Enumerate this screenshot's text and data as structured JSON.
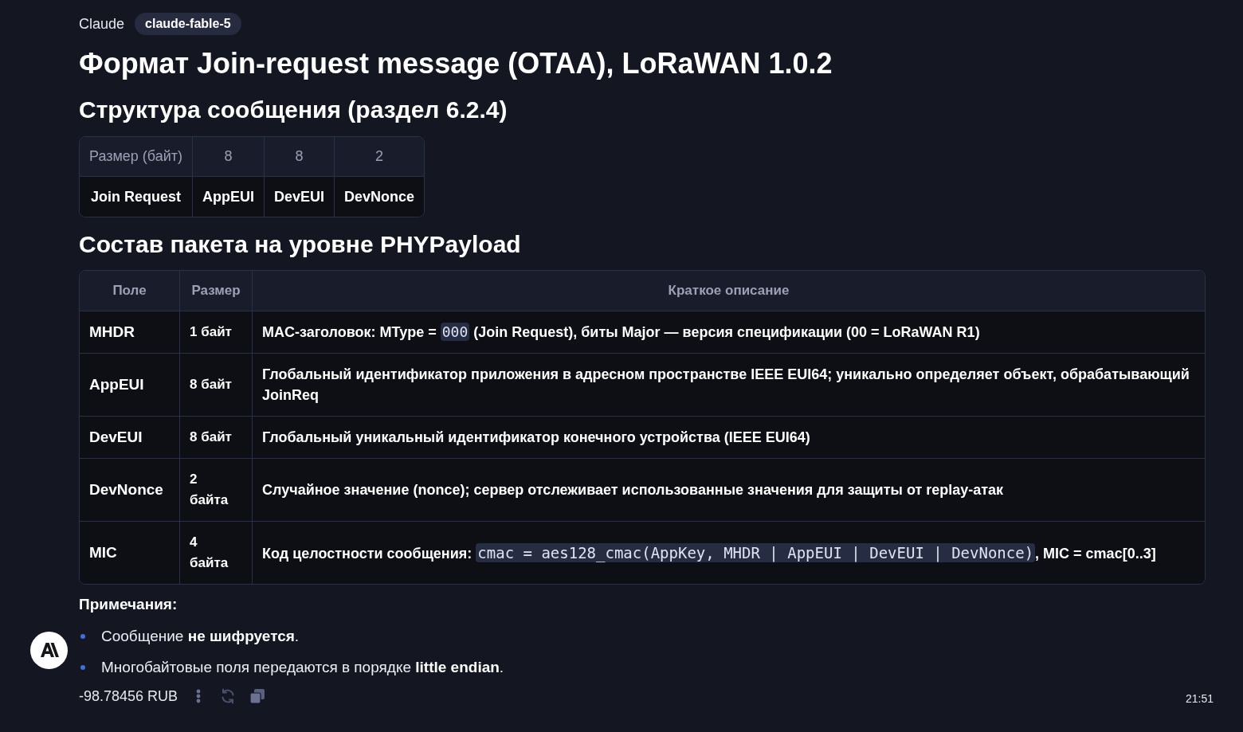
{
  "header": {
    "author": "Claude",
    "model_badge": "claude-fable-5"
  },
  "title": "Формат Join-request message (OTAA), LoRaWAN 1.0.2",
  "structure_heading": "Структура сообщения (раздел 6.2.4)",
  "structure_table": {
    "rows": [
      {
        "kind": "sizes",
        "cells": [
          "Размер (байт)",
          "8",
          "8",
          "2"
        ]
      },
      {
        "kind": "fields",
        "cells": [
          "Join Request",
          "AppEUI",
          "DevEUI",
          "DevNonce"
        ]
      }
    ]
  },
  "payload_heading": "Состав пакета на уровне PHYPayload",
  "payload_table": {
    "columns": [
      "Поле",
      "Размер",
      "Краткое описание"
    ],
    "rows": [
      {
        "field": "MHDR",
        "size": "1 байт",
        "description": [
          {
            "kind": "text",
            "text": "MAC-заголовок: MType = "
          },
          {
            "kind": "code",
            "text": "000"
          },
          {
            "kind": "text",
            "text": " (Join Request), биты Major — версия спецификации (00 = LoRaWAN R1)"
          }
        ]
      },
      {
        "field": "AppEUI",
        "size": "8 байт",
        "description": [
          {
            "kind": "text",
            "text": "Глобальный идентификатор приложения в адресном пространстве IEEE EUI64; уникально определяет объект, обрабатывающий JoinReq"
          }
        ]
      },
      {
        "field": "DevEUI",
        "size": "8 байт",
        "description": [
          {
            "kind": "text",
            "text": "Глобальный уникальный идентификатор конечного устройства (IEEE EUI64)"
          }
        ]
      },
      {
        "field": "DevNonce",
        "size": "2 байта",
        "description": [
          {
            "kind": "text",
            "text": "Случайное значение (nonce); сервер отслеживает использованные значения для защиты от replay-атак"
          }
        ]
      },
      {
        "field": "MIC",
        "size": "4 байта",
        "description": [
          {
            "kind": "text",
            "text": "Код целостности сообщения: "
          },
          {
            "kind": "code",
            "text": "cmac = aes128_cmac(AppKey, MHDR | AppEUI | DevEUI | DevNonce)"
          },
          {
            "kind": "text",
            "text": ", MIC = cmac[0..3]"
          }
        ]
      }
    ]
  },
  "notes_heading": "Примечания:",
  "notes": [
    "Сообщение **не шифруется**.",
    "Многобайтовые поля передаются в порядке **little endian**."
  ],
  "footer": {
    "cost": "-98.78456 RUB",
    "time": "21:51"
  }
}
